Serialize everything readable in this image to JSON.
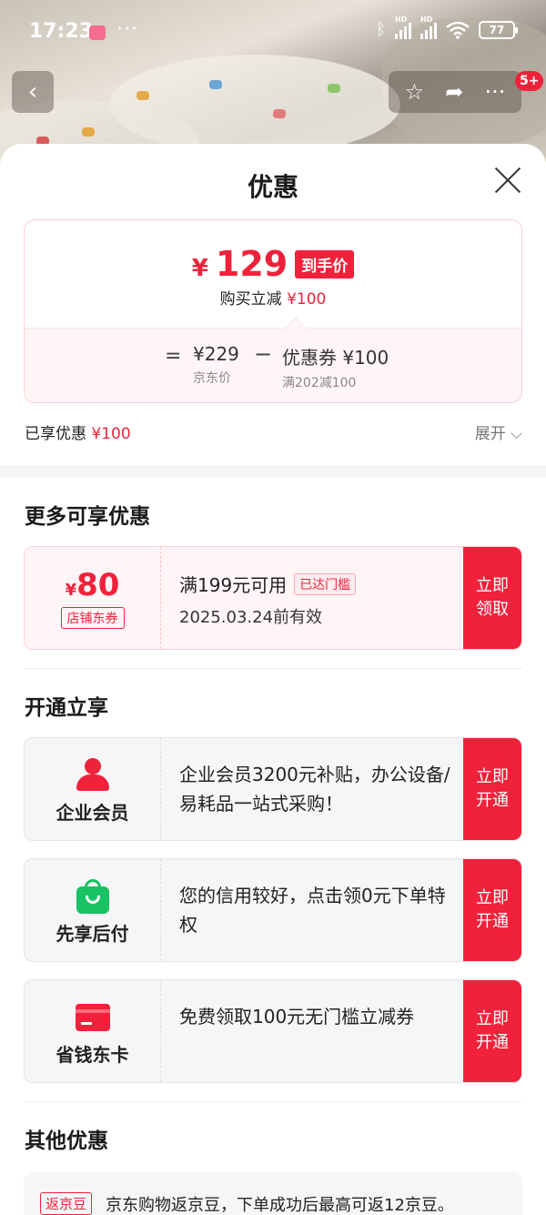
{
  "status_bar": {
    "time": "17:23",
    "more": "···",
    "sig1": "HD",
    "sig2": "HD",
    "battery": "77"
  },
  "top_actions": {
    "back": "‹",
    "star": "☆",
    "share": "➦",
    "more": "···",
    "badge": "5+"
  },
  "sheet": {
    "title": "优惠"
  },
  "price": {
    "yen": "¥",
    "amount": "129",
    "tag": "到手价",
    "sub_text": "购买立减",
    "sub_amount": "¥100",
    "eq": "=",
    "jd_price": "¥229",
    "jd_price_label": "京东价",
    "minus": "−",
    "coupon_value": "优惠券 ¥100",
    "coupon_rule": "满202减100"
  },
  "enjoyed": {
    "label": "已享优惠",
    "amount": "¥100",
    "expand": "展开 ⌵"
  },
  "more_offers": {
    "title": "更多可享优惠",
    "coupon": {
      "yen": "¥",
      "amount": "80",
      "type": "店铺东券",
      "condition": "满199元可用",
      "reached": "已达门槛",
      "expiry": "2025.03.24前有效",
      "cta_line1": "立即",
      "cta_line2": "领取"
    }
  },
  "membership": {
    "title": "开通立享",
    "items": [
      {
        "name": "企业会员",
        "desc": "企业会员3200元补贴，办公设备/易耗品一站式采购！",
        "cta_line1": "立即",
        "cta_line2": "开通",
        "icon": "person-icon"
      },
      {
        "name": "先享后付",
        "desc": "您的信用较好，点击领0元下单特权",
        "cta_line1": "立即",
        "cta_line2": "开通",
        "icon": "shopping-bag-icon"
      },
      {
        "name": "省钱东卡",
        "desc": "免费领取100元无门槛立减券",
        "cta_line1": "立即",
        "cta_line2": "开通",
        "icon": "card-icon"
      }
    ]
  },
  "other": {
    "title": "其他优惠",
    "tag": "返京豆",
    "text": "京东购物返京豆，下单成功后最高可返12京豆。"
  },
  "colors": {
    "accent": "#f0223b",
    "light_pink": "#fff5f6",
    "green": "#19c263"
  }
}
